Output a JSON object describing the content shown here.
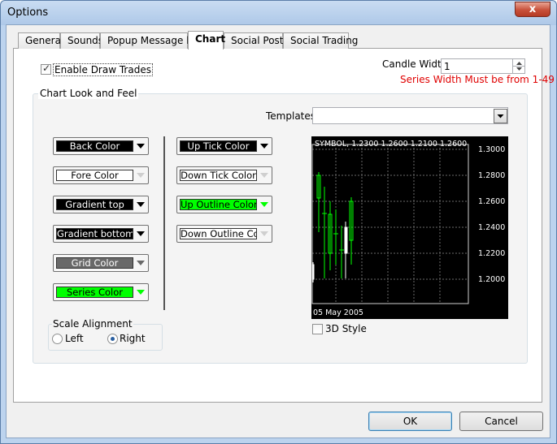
{
  "window": {
    "title": "Options",
    "close_glyph": "x"
  },
  "tabs": [
    {
      "label": "General"
    },
    {
      "label": "Sounds"
    },
    {
      "label": "Popup Message box"
    },
    {
      "label": "Chart"
    },
    {
      "label": "Social Poster"
    },
    {
      "label": "Social Trading"
    }
  ],
  "active_tab": "Chart",
  "enable_draw_trades": {
    "label": "Enable Draw Trades",
    "checked": true
  },
  "candle_width": {
    "label": "Candle Width",
    "value": "1",
    "hint": "Series Width Must be from 1-49",
    "hint_color": "#e00000"
  },
  "chart_look": {
    "group_title": "Chart Look and Feel",
    "templates_label": "Templates",
    "templates_value": "",
    "left_buttons": [
      {
        "label": "Back Color",
        "bg": "#000000",
        "fg": "#ffffff",
        "arrow_color": "#000000"
      },
      {
        "label": "Fore Color",
        "bg": "#ffffff",
        "fg": "#000000",
        "arrow_color": "#ffffff"
      },
      {
        "label": "Gradient top",
        "bg": "#000000",
        "fg": "#ffffff",
        "arrow_color": "#000000"
      },
      {
        "label": "Gradient bottom",
        "bg": "#000000",
        "fg": "#ffffff",
        "arrow_color": "#000000"
      },
      {
        "label": "Grid Color",
        "bg": "#696969",
        "fg": "#ffffff",
        "arrow_color": "#696969"
      },
      {
        "label": "Series Color",
        "bg": "#00ff00",
        "fg": "#000000",
        "arrow_color": "#00ff00"
      }
    ],
    "right_buttons": [
      {
        "label": "Up Tick Color",
        "bg": "#000000",
        "fg": "#ffffff",
        "arrow_color": "#000000"
      },
      {
        "label": "Down Tick Color",
        "bg": "#ffffff",
        "fg": "#000000",
        "arrow_color": "#ffffff"
      },
      {
        "label": "Up Outline Color",
        "bg": "#00ff00",
        "fg": "#000000",
        "arrow_color": "#00ff00"
      },
      {
        "label": "Down Outline Color",
        "bg": "#ffffff",
        "fg": "#000000",
        "arrow_color": "#ffffff"
      }
    ],
    "scale_alignment": {
      "title": "Scale Alignment",
      "options": [
        {
          "label": "Left",
          "checked": false
        },
        {
          "label": "Right",
          "checked": true
        }
      ]
    },
    "style_3d": {
      "label": "3D Style",
      "checked": false
    }
  },
  "chart_preview": {
    "header": "SYMBOL, 1.2300 1.2600 1.2100 1.2600",
    "y_ticks": [
      "1.3000",
      "1.2800",
      "1.2600",
      "1.2400",
      "1.2200",
      "1.2000"
    ],
    "x_label": "05 May 2005"
  },
  "buttons": {
    "ok": "OK",
    "cancel": "Cancel"
  }
}
